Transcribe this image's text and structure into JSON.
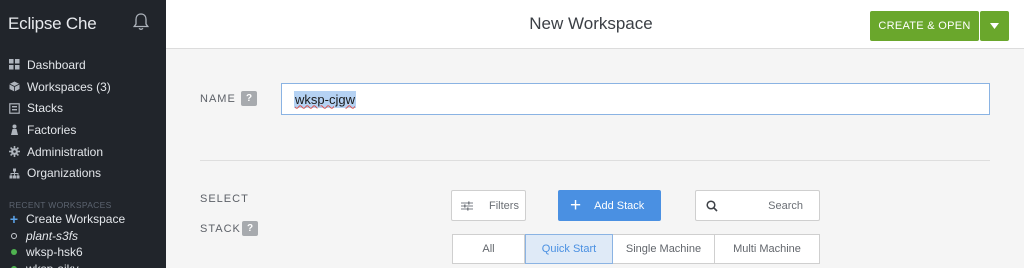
{
  "sidebar": {
    "brand": "Eclipse Che",
    "bell_icon": "bell-icon",
    "nav": [
      {
        "label": "Dashboard",
        "icon": "dashboard-icon"
      },
      {
        "label": "Workspaces (3)",
        "icon": "cube-icon"
      },
      {
        "label": "Stacks",
        "icon": "stack-icon"
      },
      {
        "label": "Factories",
        "icon": "factory-icon"
      },
      {
        "label": "Administration",
        "icon": "gear-icon"
      },
      {
        "label": "Organizations",
        "icon": "org-icon"
      }
    ],
    "recent_heading": "RECENT WORKSPACES",
    "recent": [
      {
        "label": "Create Workspace",
        "icon": "plus-icon"
      },
      {
        "label": "plant-s3fs",
        "status": "stopped"
      },
      {
        "label": "wksp-hsk6",
        "status": "running"
      },
      {
        "label": "wksp-ajkv",
        "status": "running"
      }
    ]
  },
  "header": {
    "title": "New Workspace",
    "create_open_label": "CREATE & OPEN",
    "caret_icon": "chevron-down-icon"
  },
  "form": {
    "name_label": "NAME",
    "name_help": "?",
    "name_value": "wksp-cjgw",
    "stack_label_line1": "SELECT",
    "stack_label_line2": "STACK",
    "stack_help": "?",
    "filters_label": "Filters",
    "add_stack_label": "Add Stack",
    "search_placeholder": "Search",
    "tabs": [
      {
        "label": "All",
        "active": false
      },
      {
        "label": "Quick Start",
        "active": true
      },
      {
        "label": "Single Machine",
        "active": false
      },
      {
        "label": "Multi Machine",
        "active": false
      }
    ]
  },
  "colors": {
    "sidebar_bg": "#21252b",
    "primary_green": "#6aa72c",
    "primary_blue": "#4a90e2"
  }
}
